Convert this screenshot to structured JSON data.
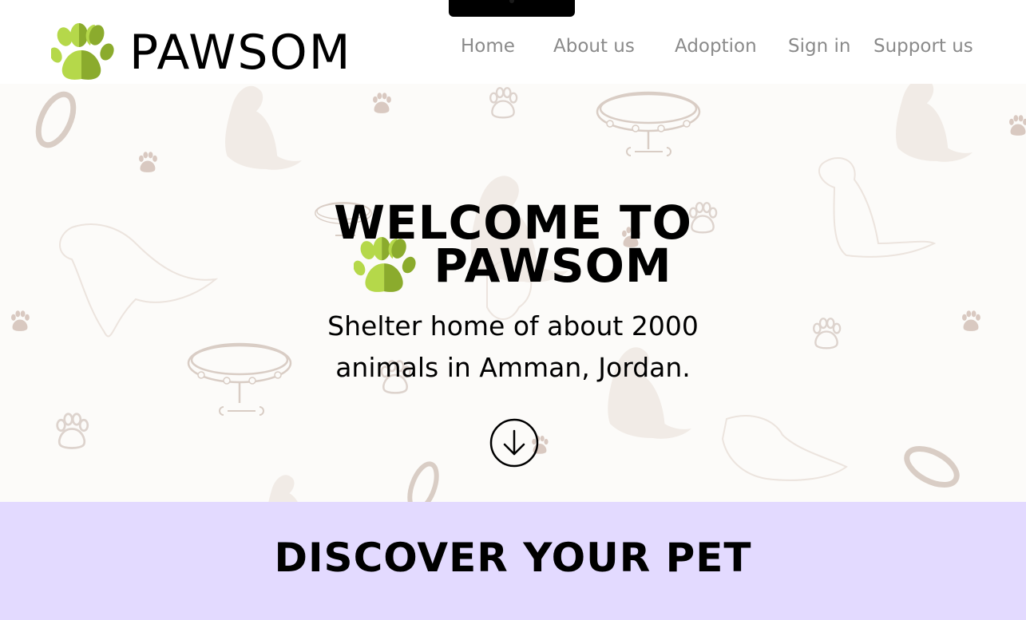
{
  "brand": {
    "name": "PAWSOM",
    "logo_icon": "paw-icon"
  },
  "nav": {
    "items": [
      {
        "label": "Home"
      },
      {
        "label": "About us"
      },
      {
        "label": "Adoption"
      },
      {
        "label": "Sign in"
      },
      {
        "label": "Support us"
      }
    ]
  },
  "hero": {
    "title_line1": "WELCOME TO",
    "title_brand": "PAWSOM",
    "subtitle_line1": "Shelter home of about 2000",
    "subtitle_line2": "animals in Amman, Jordan.",
    "scroll_icon": "arrow-down-circle-icon"
  },
  "discover": {
    "title": "DISCOVER YOUR PET"
  },
  "colors": {
    "paw_light": "#b5d84a",
    "paw_dark": "#8bab2d",
    "nav_text": "#8a8a8a",
    "hero_bg": "#fcfbf9",
    "pattern": "#eae2dc",
    "discover_bg": "#e3daff"
  }
}
